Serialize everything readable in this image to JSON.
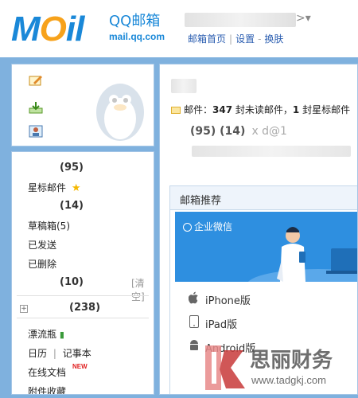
{
  "header": {
    "logo_text": "MOil",
    "logo_cn": "QQ邮箱",
    "logo_en": "mail.qq.com",
    "user_suffix": ">▾",
    "links": [
      "邮箱首页",
      "设置",
      "换肤"
    ]
  },
  "left_actions": [
    {
      "icon": "compose-icon"
    },
    {
      "icon": "inbox-download-icon"
    },
    {
      "icon": "contacts-card-icon"
    }
  ],
  "sidebar": {
    "inbox_count": "(95)",
    "starred_label": "星标邮件",
    "group_count": "(14)",
    "drafts_label": "草稿箱(5)",
    "sent_label": "已发送",
    "deleted_label": "已删除",
    "deleted_count": "(10)",
    "clear_label": "[清空]",
    "plus_symbol": "+",
    "folder_count": "(238)",
    "bottle_label": "漂流瓶",
    "calendar_label": "日历",
    "notes_label": "记事本",
    "docs_label": "在线文档",
    "new_badge": "NEW",
    "attach_label": "附件收藏"
  },
  "main": {
    "mail_prefix": "邮件：",
    "unread_count": "347",
    "unread_text": "封未读邮件，",
    "starred_count": "1",
    "starred_text": "封星标邮件",
    "num1": "(95)",
    "num2": "(14)",
    "addr_partial": "x        d@1"
  },
  "recommend": {
    "title": "邮箱推荐",
    "banner_label": "企业微信",
    "clients": [
      {
        "icon": "apple-icon",
        "label": "iPhone版"
      },
      {
        "icon": "tablet-icon",
        "label": "iPad版"
      },
      {
        "icon": "android-icon",
        "label": "Android版"
      }
    ]
  },
  "watermark": {
    "brand": "思丽财务",
    "url": "www.tadgkj.com"
  },
  "colors": {
    "brand_blue": "#1a88d8",
    "frame_blue": "#7fb1de",
    "banner_blue": "#2e8fe0"
  }
}
